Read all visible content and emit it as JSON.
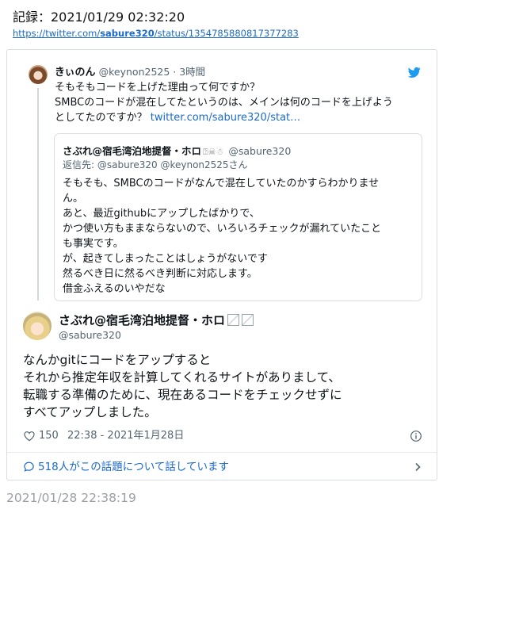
{
  "header": {
    "record": "記録：2021/01/29 02:32:20",
    "link_prefix": "https://twitter.com/",
    "link_bold": "sabure320",
    "link_suffix": "/status/1354785880817377283"
  },
  "reply_tweet": {
    "name": "きぃのん",
    "handle": "@keynon2525",
    "time": " · 3時間",
    "lines": [
      "そもそもコードを上げた理由って何ですか？",
      "SMBCのコードが混在してたというのは、メインは何のコードを上げよう",
      "としてたのですか？ "
    ],
    "link_text": "twitter.com/sabure320/stat…"
  },
  "quoted_tweet": {
    "name": "さぶれ@宿毛湾泊地提督・ホロ",
    "emoji": "⍰☠☃",
    "handle": "@sabure320",
    "reply_to": "返信先: @sabure320 @keynon2525さん",
    "lines": [
      "そもそも、SMBCのコードがなんで混在していたのかすらわかりませ",
      "ん。",
      "あと、最近githubにアップしたばかりで、",
      "かつ使い方もままならないので、いろいろチェックが漏れていたこと",
      "も事実です。",
      "が、起きてしまったことはしょうがないです",
      "然るべき日に然るべき判断に対応します。",
      "借金ふえるのいやだな"
    ]
  },
  "main_tweet": {
    "name": "さぶれ@宿毛湾泊地提督・ホロ",
    "handle": "@sabure320",
    "lines": [
      "なんかgitにコードをアップすると",
      "それから推定年収を計算してくれるサイトがありまして、",
      "転職する準備のために、現在あるコードをチェックせずに",
      "すべてアップしました。"
    ],
    "likes": "150",
    "timestamp": "22:38 - 2021年1月28日"
  },
  "conversation": {
    "label": "518人がこの話題について話しています"
  },
  "footer": {
    "timestamp": "2021/01/28 22:38:19"
  },
  "colors": {
    "link": "#1b6ac9",
    "twitter_blue": "#1d9bf0",
    "muted": "#536471",
    "border": "#d9dee3"
  },
  "icons": [
    "twitter-bird-icon",
    "heart-icon",
    "info-icon",
    "speech-bubble-icon",
    "chevron-right-icon"
  ]
}
